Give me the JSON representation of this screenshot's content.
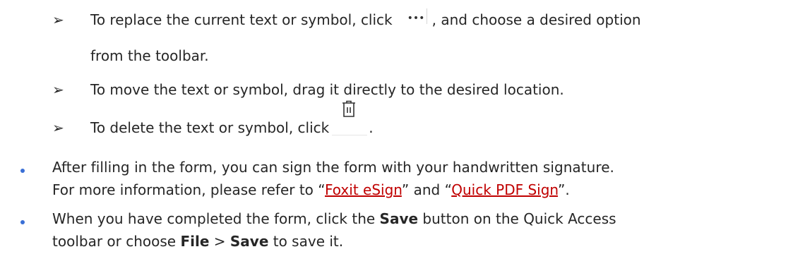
{
  "sub_items": [
    {
      "text_before": "To replace the current text or symbol, click",
      "icon": "more-options-icon",
      "text_after": ", and choose a desired option",
      "continuation": "from the toolbar."
    },
    {
      "text": "To move the text or symbol, drag it directly to the desired location."
    },
    {
      "text_before": "To delete the text or symbol, click",
      "icon": "trash-icon",
      "text_after": "."
    }
  ],
  "bullets": [
    {
      "line1": "After filling in the form, you can sign the form with your handwritten signature.",
      "line2_prefix": "For more information, please refer to “",
      "link1": "Foxit eSign",
      "line2_mid": "” and “",
      "link2": "Quick PDF Sign",
      "line2_suffix": "”."
    },
    {
      "line1_prefix": "When you have completed the form, click the ",
      "bold1": "Save",
      "line1_suffix": " button on the Quick Access",
      "line2_prefix": "toolbar or choose ",
      "bold2": "File",
      "line2_mid": " > ",
      "bold3": "Save",
      "line2_suffix": " to save it."
    }
  ],
  "colors": {
    "text": "#262626",
    "link": "#c00000",
    "bullet": "#3a6fd6"
  }
}
